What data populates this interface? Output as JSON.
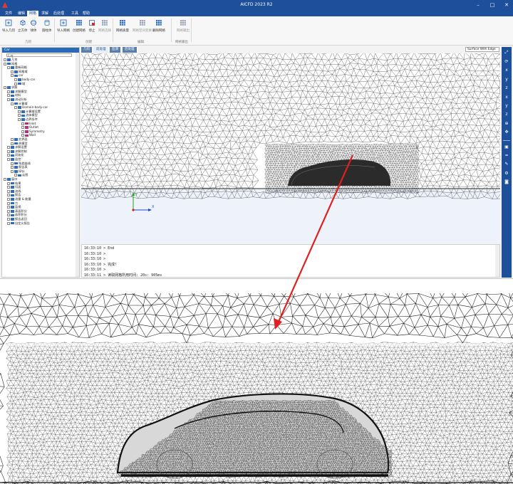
{
  "window": {
    "title": "AICFD 2023 R2"
  },
  "menu": {
    "items": [
      "文件",
      "编辑",
      "网格",
      "求解",
      "后处理",
      "工具",
      "帮助"
    ],
    "active_index": 2
  },
  "ribbon": {
    "buttons": [
      {
        "label": "导入几何",
        "icon": "import-geometry-icon"
      },
      {
        "label": "立方体",
        "icon": "cube-icon"
      },
      {
        "label": "球体",
        "icon": "sphere-icon"
      },
      {
        "label": "圆柱体",
        "icon": "cylinder-icon"
      },
      {
        "label": "导入网格",
        "icon": "import-mesh-icon"
      },
      {
        "label": "创建网格",
        "icon": "create-mesh-icon"
      },
      {
        "label": "停止",
        "icon": "stop-icon"
      },
      {
        "label": "网格选择",
        "icon": "mesh-select-icon"
      },
      {
        "label": "网格质量",
        "icon": "mesh-quality-icon"
      },
      {
        "label": "网格空间变换",
        "icon": "mesh-transform-icon"
      },
      {
        "label": "删除网格",
        "icon": "delete-mesh-icon"
      },
      {
        "label": "网格输出",
        "icon": "mesh-export-icon"
      }
    ],
    "groups": [
      "几何",
      "创建",
      "编辑",
      "网格输出"
    ]
  },
  "tree": {
    "header": "Car",
    "search_placeholder": "几何",
    "nodes": [
      {
        "label": "几何",
        "level": 0
      },
      {
        "label": "网格",
        "level": 0
      },
      {
        "label": "重新网格",
        "level": 1
      },
      {
        "label": "网格域",
        "level": 2
      },
      {
        "label": "car",
        "level": 2
      },
      {
        "label": "body-car",
        "level": 3
      },
      {
        "label": "域",
        "level": 3
      },
      {
        "label": "求解",
        "level": 0
      },
      {
        "label": "求解模型",
        "level": 1
      },
      {
        "label": "材料",
        "level": 1
      },
      {
        "label": "流动分析",
        "level": 1
      },
      {
        "label": "计算域",
        "level": 2
      },
      {
        "label": "Domain-body-car",
        "level": 3
      },
      {
        "label": "计算域设置",
        "level": 4
      },
      {
        "label": "流体模型",
        "level": 4
      },
      {
        "label": "边界条件",
        "level": 4
      },
      {
        "label": "Inlet",
        "level": 5
      },
      {
        "label": "Outlet",
        "level": 5
      },
      {
        "label": "Symmetry",
        "level": 5
      },
      {
        "label": "Wall",
        "level": 5
      },
      {
        "label": "交界面",
        "level": 2
      },
      {
        "label": "热模型",
        "level": 2
      },
      {
        "label": "求解设置",
        "level": 1
      },
      {
        "label": "求解控制",
        "level": 1
      },
      {
        "label": "初始化",
        "level": 1
      },
      {
        "label": "监控",
        "level": 1
      },
      {
        "label": "残差曲线",
        "level": 2
      },
      {
        "label": "报告表",
        "level": 2
      },
      {
        "label": "探针",
        "level": 2
      },
      {
        "label": "云图",
        "level": 3
      },
      {
        "label": "窗口",
        "level": 0
      },
      {
        "label": "结果",
        "level": 1
      },
      {
        "label": "切面",
        "level": 1
      },
      {
        "label": "流线",
        "level": 1
      },
      {
        "label": "报告",
        "level": 1
      },
      {
        "label": "流量 & 能量",
        "level": 1
      },
      {
        "label": "力",
        "level": 1
      },
      {
        "label": "监视",
        "level": 1
      },
      {
        "label": "表面积分",
        "level": 1
      },
      {
        "label": "体积积分",
        "level": 1
      },
      {
        "label": "报告返回",
        "level": 1
      },
      {
        "label": "自定义报告",
        "level": 1
      }
    ]
  },
  "view_tabs": [
    "几何",
    "前处理",
    "监测",
    "后处理"
  ],
  "view_tab_active": 1,
  "display_mode": "Surface With Edge",
  "axes": {
    "x": "X",
    "y": "Y"
  },
  "console": {
    "lines": [
      "16:33:10 > End",
      "16:33:10 >",
      "16:33:10 >",
      "16:33:10 > 完成!",
      "16:33:10 >",
      "16:33:11 > 读取网格所用时间: 20s: 905ms"
    ]
  },
  "right_toolbar": {
    "icons": [
      "fit-view-icon",
      "rotate-icon",
      "view-x-icon",
      "view-y-icon",
      "view-z-icon",
      "view-neg-x-icon",
      "view-neg-y-icon",
      "view-neg-z-icon",
      "zoom-icon",
      "pan-icon",
      "select-icon",
      "ruler-icon",
      "probe-icon",
      "settings-icon",
      "camera-icon"
    ]
  },
  "colors": {
    "title_bar": "#1e4f9a",
    "accent": "#2a6ab8",
    "arrow": "#e02020",
    "mesh": "#1a1a1a"
  }
}
